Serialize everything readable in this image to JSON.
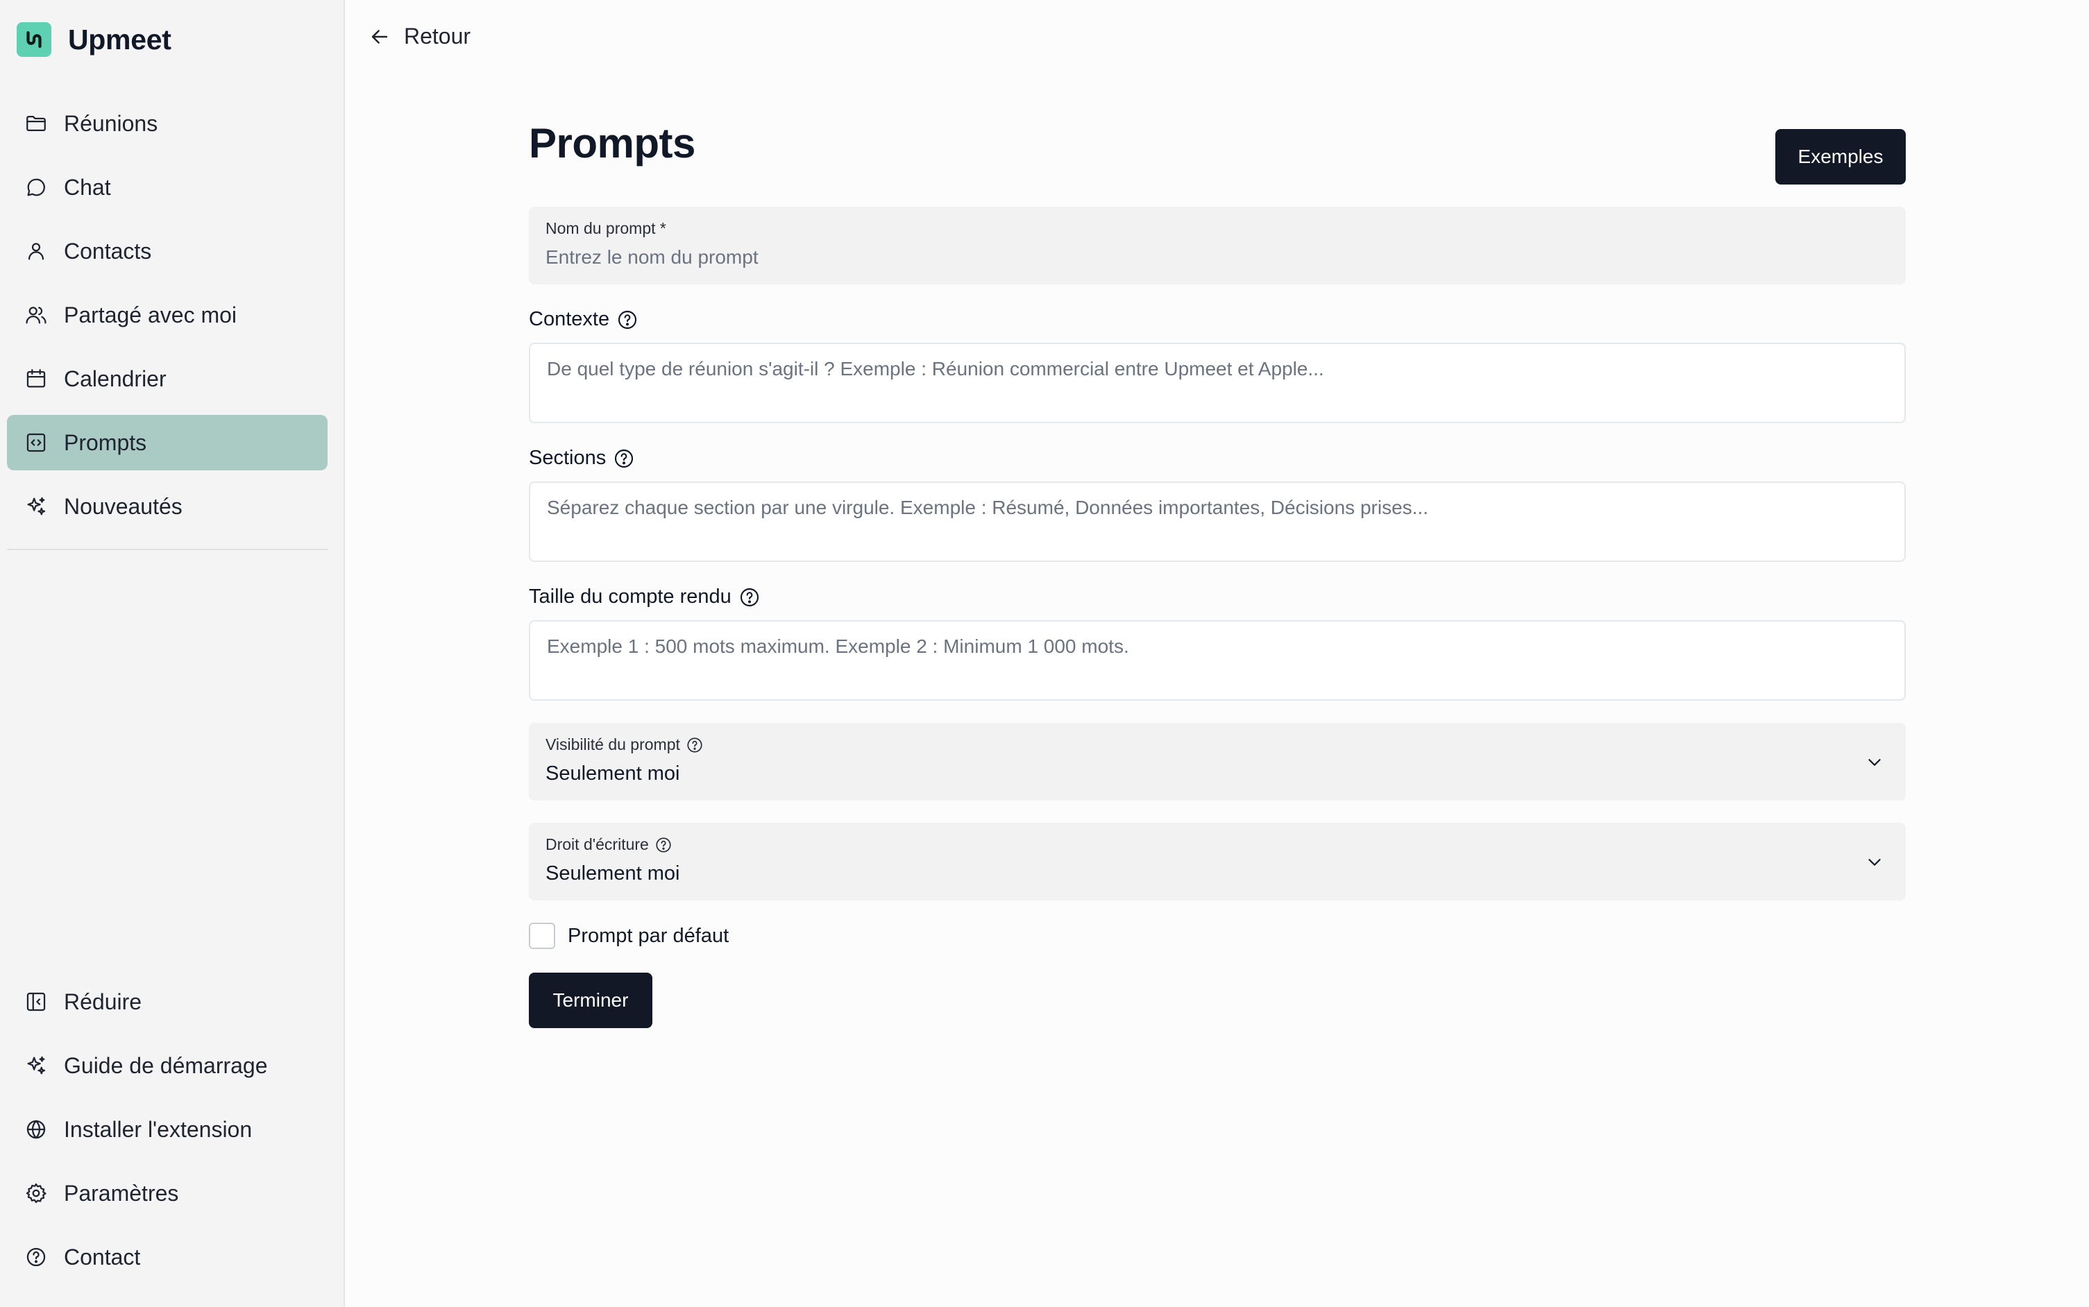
{
  "brand": {
    "name": "Upmeet",
    "color": "#5ed1b3"
  },
  "sidebar": {
    "items": [
      {
        "label": "Réunions",
        "icon": "folder-icon"
      },
      {
        "label": "Chat",
        "icon": "chat-bubble-icon"
      },
      {
        "label": "Contacts",
        "icon": "user-icon"
      },
      {
        "label": "Partagé avec moi",
        "icon": "users-icon"
      },
      {
        "label": "Calendrier",
        "icon": "calendar-icon"
      },
      {
        "label": "Prompts",
        "icon": "prompt-code-icon",
        "active": true
      },
      {
        "label": "Nouveautés",
        "icon": "sparkles-icon"
      }
    ],
    "bottom_items": [
      {
        "label": "Réduire",
        "icon": "collapse-panel-icon"
      },
      {
        "label": "Guide de démarrage",
        "icon": "sparkles-icon"
      },
      {
        "label": "Installer l'extension",
        "icon": "globe-icon"
      },
      {
        "label": "Paramètres",
        "icon": "gear-icon"
      },
      {
        "label": "Contact",
        "icon": "help-circle-icon"
      }
    ],
    "active_color": "#a9cbc4"
  },
  "header": {
    "back_label": "Retour"
  },
  "page": {
    "title": "Prompts",
    "examples_button": "Exemples"
  },
  "form": {
    "name": {
      "label": "Nom du prompt *",
      "placeholder": "Entrez le nom du prompt"
    },
    "context": {
      "label": "Contexte",
      "placeholder": "De quel type de réunion s'agit-il ? Exemple : Réunion commercial entre Upmeet et Apple..."
    },
    "sections": {
      "label": "Sections",
      "placeholder": "Séparez chaque section par une virgule. Exemple : Résumé, Données importantes, Décisions prises..."
    },
    "size": {
      "label": "Taille du compte rendu",
      "placeholder": "Exemple 1 : 500 mots maximum. Exemple 2 : Minimum 1 000 mots."
    },
    "visibility": {
      "label": "Visibilité du prompt",
      "value": "Seulement moi"
    },
    "write_access": {
      "label": "Droit d'écriture",
      "value": "Seulement moi"
    },
    "default_checkbox": {
      "label": "Prompt par défaut",
      "checked": false
    },
    "submit_label": "Terminer"
  },
  "colors": {
    "primary_dark": "#121826"
  }
}
